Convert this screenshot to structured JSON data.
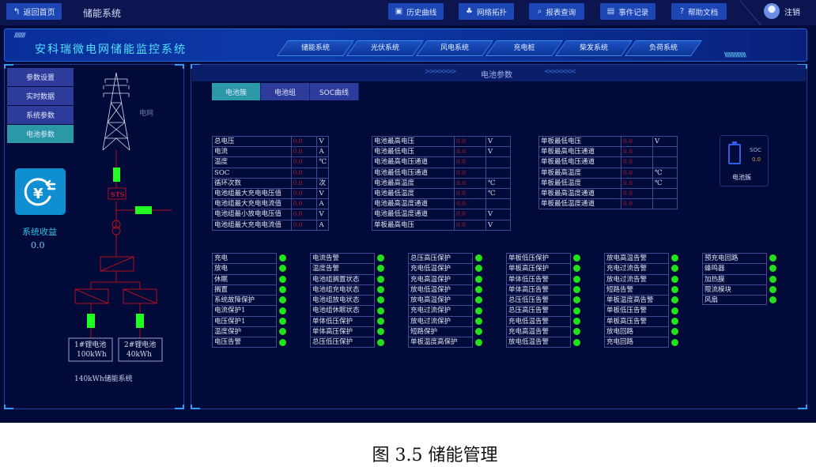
{
  "topbar": {
    "back_label": "返回首页",
    "app_title": "储能系统",
    "buttons": [
      {
        "label": "历史曲线",
        "icon": "chart-icon"
      },
      {
        "label": "网络拓扑",
        "icon": "topology-icon"
      },
      {
        "label": "报表查询",
        "icon": "search-icon"
      },
      {
        "label": "事件记录",
        "icon": "document-icon"
      },
      {
        "label": "帮助文档",
        "icon": "help-icon"
      }
    ],
    "logout_label": "注销"
  },
  "header": {
    "title": "安科瑞微电网储能监控系统",
    "nav_tabs": [
      "储能系统",
      "光伏系统",
      "风电系统",
      "充电桩",
      "柴发系统",
      "负荷系统"
    ],
    "active_tab": "储能系统"
  },
  "sidebar": {
    "menu": [
      "参数设置",
      "实时数据",
      "系统参数",
      "电池参数"
    ],
    "active_menu": "电池参数",
    "income_label": "系统收益",
    "income_value": "0.0"
  },
  "diagram": {
    "grid_label": "电网",
    "sts_label": "STS",
    "battery1": {
      "name": "1#锂电池",
      "capacity": "100kWh"
    },
    "battery2": {
      "name": "2#锂电池",
      "capacity": "40kWh"
    },
    "system_label": "140kWh储能系统",
    "colors": {
      "line": "#b01020",
      "switch_on": "#22ff22"
    }
  },
  "main": {
    "title": "电池参数",
    "sub_tabs": [
      "电池簇",
      "电池组",
      "SOC曲线"
    ],
    "active_sub_tab": "电池簇",
    "table1": [
      {
        "name": "总电压",
        "value": "0.0",
        "unit": "V"
      },
      {
        "name": "电流",
        "value": "0.0",
        "unit": "A"
      },
      {
        "name": "温度",
        "value": "0.0",
        "unit": "℃"
      },
      {
        "name": "SOC",
        "value": "0.0",
        "unit": ""
      },
      {
        "name": "循环次数",
        "value": "0.0",
        "unit": "次"
      },
      {
        "name": "电池组最大充电电压值",
        "value": "0.0",
        "unit": "V"
      },
      {
        "name": "电池组最大充电电流值",
        "value": "0.0",
        "unit": "A"
      },
      {
        "name": "电池组最小放电电压值",
        "value": "0.0",
        "unit": "V"
      },
      {
        "name": "电池组最大充电电流值",
        "value": "0.0",
        "unit": "A"
      }
    ],
    "table2": [
      {
        "name": "电池最高电压",
        "value": "0.0",
        "unit": "V"
      },
      {
        "name": "电池最低电压",
        "value": "0.0",
        "unit": "V"
      },
      {
        "name": "电池最高电压通道",
        "value": "0.0",
        "unit": ""
      },
      {
        "name": "电池最低电压通道",
        "value": "0.0",
        "unit": ""
      },
      {
        "name": "电池最高温度",
        "value": "0.0",
        "unit": "℃"
      },
      {
        "name": "电池最低温度",
        "value": "0.0",
        "unit": "℃"
      },
      {
        "name": "电池最高温度通道",
        "value": "0.0",
        "unit": ""
      },
      {
        "name": "电池最低温度通道",
        "value": "0.0",
        "unit": "V"
      },
      {
        "name": "单板最高电压",
        "value": "0.0",
        "unit": "V"
      }
    ],
    "table3": [
      {
        "name": "单板最低电压",
        "value": "0.0",
        "unit": "V"
      },
      {
        "name": "单板最高电压通道",
        "value": "0.0",
        "unit": ""
      },
      {
        "name": "单板最低电压通道",
        "value": "0.0",
        "unit": ""
      },
      {
        "name": "单板最高温度",
        "value": "0.0",
        "unit": "℃"
      },
      {
        "name": "单板最低温度",
        "value": "0.0",
        "unit": "℃"
      },
      {
        "name": "单板最高温度通道",
        "value": "0.0",
        "unit": ""
      },
      {
        "name": "单板最低温度通道",
        "value": "0.0",
        "unit": ""
      }
    ],
    "soc_card": {
      "label": "SOC",
      "value": "0.0",
      "name": "电池簇"
    },
    "status_columns": [
      [
        "充电",
        "放电",
        "休眠",
        "搁置",
        "系统故障保护",
        "电流保护1",
        "电压保护1",
        "温度保护",
        "电压告警"
      ],
      [
        "电流告警",
        "温度告警",
        "电池组搁置状态",
        "电池组充电状态",
        "电池组放电状态",
        "电池组休眠状态",
        "单体低压保护",
        "单体高压保护",
        "总压低压保护"
      ],
      [
        "总压高压保护",
        "充电低温保护",
        "充电高温保护",
        "放电低温保护",
        "放电高温保护",
        "充电过流保护",
        "放电过流保护",
        "短路保护",
        "单板温度高保护"
      ],
      [
        "单板低压保护",
        "单板高压保护",
        "单体低压告警",
        "单体高压告警",
        "总压低压告警",
        "总压高压告警",
        "充电低温告警",
        "充电高温告警",
        "放电低温告警"
      ],
      [
        "放电高温告警",
        "充电过流告警",
        "放电过流告警",
        "短路告警",
        "单板温度高告警",
        "单板低压告警",
        "单板高压告警",
        "放电回路",
        "充电回路"
      ],
      [
        "预充电回路",
        "蜂鸣器",
        "加热膜",
        "限流模块",
        "风扇"
      ]
    ],
    "status_color": "#22e01a",
    "value_color": "#b51a2a"
  },
  "caption": "图 3.5 储能管理"
}
